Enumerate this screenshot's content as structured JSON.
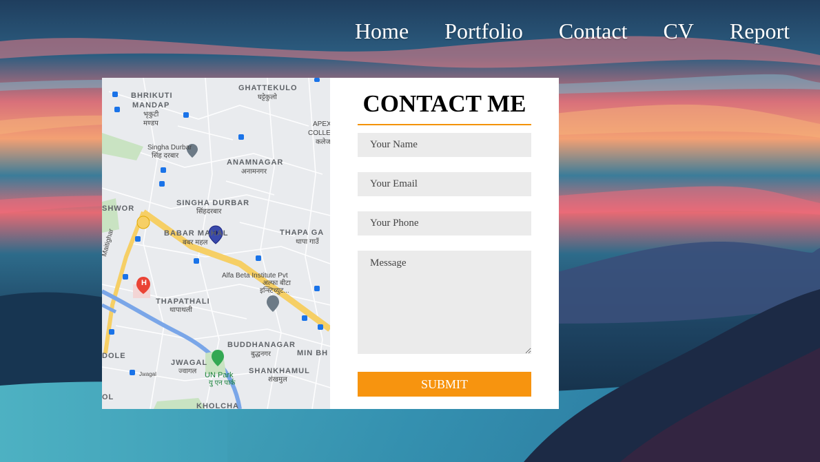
{
  "nav": {
    "items": [
      {
        "label": "Home"
      },
      {
        "label": "Portfolio"
      },
      {
        "label": "Contact"
      },
      {
        "label": "CV"
      },
      {
        "label": "Report"
      }
    ]
  },
  "contact": {
    "title": "CONTACT ME",
    "name_placeholder": "Your Name",
    "email_placeholder": "Your Email",
    "phone_placeholder": "Your Phone",
    "message_placeholder": "Message",
    "submit_label": "SUBMIT",
    "accent_color": "#f7940f"
  },
  "map": {
    "labels": {
      "bhrikuti": "BHRIKUTI",
      "mandap": "MANDAP",
      "bhrikuti_np": "भृकुटी",
      "mandap_np": "मण्डप",
      "ghattekulo": "GHATTEKULO",
      "ghattekulo_np": "घट्टेकुलो",
      "apex": "APEX",
      "college": "COLLE",
      "college_np": "कलेज",
      "singha_durbar_poi": "Singha Durbar",
      "singha_durbar_poi_np": "सिंह दरबार",
      "anamnagar": "ANAMNAGAR",
      "anamnagar_np": "अनामनगर",
      "shwor": "SHWOR",
      "singha_durbar": "SINGHA DURBAR",
      "singha_durbar_np": "सिंहदरबार",
      "babar_mahal": "BABAR MAHAL",
      "babar_mahal_np": "बबर महल",
      "thapa_gaun": "THAPA GA",
      "thapa_gaun_np": "थापा गाउँ",
      "alfa_beta": "Alfa Beta Institute Pvt",
      "alfa_beta_np": "अल्फा बीटा",
      "alfa_beta_np2": "इन्स्टिच्युट...",
      "thapathali": "THAPATHALI",
      "thapathali_np": "थापाथली",
      "buddhanagar": "BUDDHANAGAR",
      "buddhanagar_np": "बुद्धनगर",
      "min_bh": "MIN BH",
      "dole": "DOLE",
      "jwagal": "JWAGAL",
      "jwagal_np": "ज्वागल",
      "un_park": "UN Park",
      "un_park_np": "यु एन पार्क",
      "shankhamul": "SHANKHAMUL",
      "shankhamul_np": "शंखमुल",
      "khokna_ol": "OL",
      "kholcha": "KHOLCHA",
      "maitighar": "Maitighar",
      "jwagal_road": "Jwagal",
      "hospital_letter": "H"
    }
  }
}
